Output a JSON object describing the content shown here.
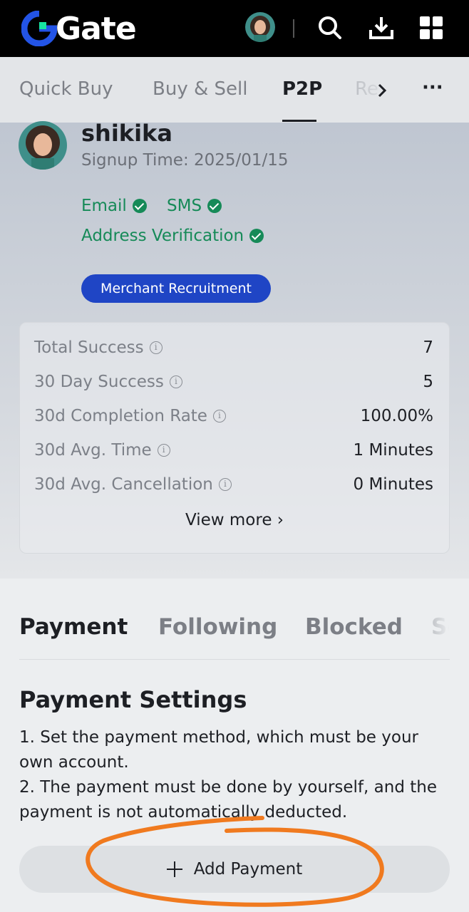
{
  "brand": {
    "logo_text": "Gate",
    "accent": "#1f45c5",
    "logo_green": "#17e5a0",
    "logo_blue": "#2354e6"
  },
  "topbar": {
    "icons": [
      "avatar",
      "search-icon",
      "download-icon",
      "apps-grid-icon"
    ]
  },
  "nav": {
    "tabs": [
      "Quick Buy",
      "Buy & Sell",
      "P2P",
      "Re"
    ],
    "active": "P2P",
    "more_label": "···"
  },
  "profile": {
    "name": "shikika",
    "signup": "Signup Time: 2025/01/15",
    "verifications": [
      "Email",
      "SMS",
      "Address Verification"
    ],
    "merchant_button": "Merchant Recruitment"
  },
  "stats": {
    "rows": [
      {
        "label": "Total Success",
        "value": "7"
      },
      {
        "label": "30 Day Success",
        "value": "5"
      },
      {
        "label": "30d Completion Rate",
        "value": "100.00%"
      },
      {
        "label": "30d Avg. Time",
        "value": "1 Minutes"
      },
      {
        "label": "30d Avg. Cancellation",
        "value": "0 Minutes"
      }
    ],
    "view_more": "View more ›"
  },
  "payment_tabs": [
    "Payment",
    "Following",
    "Blocked",
    "Se"
  ],
  "payment_settings": {
    "title": "Payment Settings",
    "line1": "1. Set the payment method, which must be your own account.",
    "line2": "2. The payment must be done by yourself, and the payment is not automatically deducted.",
    "add_button": "Add Payment"
  },
  "annotation_color": "#f07a1f"
}
